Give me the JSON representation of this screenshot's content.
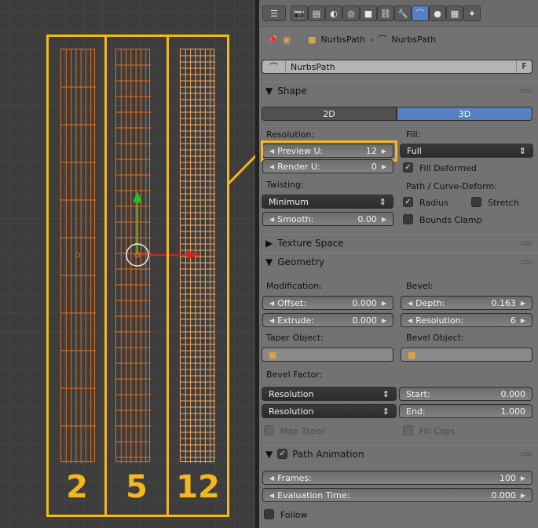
{
  "viewport": {
    "labels": [
      "2",
      "5",
      "12"
    ],
    "wire_color": "#e0701d",
    "highlight_color": "#f4b71c",
    "objects": [
      {
        "resolution_label": "2"
      },
      {
        "resolution_label": "5"
      },
      {
        "resolution_label": "12"
      }
    ]
  },
  "header": {
    "context_icons": [
      "render-icon",
      "render-layers-icon",
      "scene-icon",
      "world-icon",
      "object-icon",
      "constraints-icon",
      "modifiers-icon",
      "curve-data-icon",
      "material-icon",
      "texture-icon",
      "particles-icon"
    ]
  },
  "breadcrumb": {
    "object": "NurbsPath",
    "data": "NurbsPath"
  },
  "datablock": {
    "name": "NurbsPath",
    "fake_user": "F"
  },
  "shape": {
    "title": "Shape",
    "tab_2d": "2D",
    "tab_3d": "3D",
    "resolution_label": "Resolution:",
    "preview_u_label": "Preview U:",
    "preview_u": "12",
    "render_u_label": "Render U:",
    "render_u": "0",
    "fill_label": "Fill:",
    "fill_value": "Full",
    "fill_deformed": "Fill Deformed",
    "twisting_label": "Twisting:",
    "twisting_value": "Minimum",
    "smooth_label": "Smooth:",
    "smooth_value": "0.00",
    "path_deform_label": "Path / Curve-Deform:",
    "radius": "Radius",
    "stretch": "Stretch",
    "bounds_clamp": "Bounds Clamp"
  },
  "texture_space": {
    "title": "Texture Space"
  },
  "geometry": {
    "title": "Geometry",
    "modification_label": "Modification:",
    "offset_label": "Offset:",
    "offset": "0.000",
    "extrude_label": "Extrude:",
    "extrude": "0.000",
    "bevel_label": "Bevel:",
    "depth_label": "Depth:",
    "depth": "0.163",
    "resolution_label": "Resolution:",
    "resolution": "6",
    "taper_object_label": "Taper Object:",
    "bevel_object_label": "Bevel Object:",
    "bevel_factor_label": "Bevel Factor:",
    "bf_mode_1": "Resolution",
    "bf_mode_2": "Resolution",
    "start_label": "Start:",
    "start": "0.000",
    "end_label": "End:",
    "end": "1.000",
    "map_taper": "Map Taper",
    "fill_caps": "Fill Caps"
  },
  "path_animation": {
    "title": "Path Animation",
    "frames_label": "Frames:",
    "frames": "100",
    "eval_label": "Evaluation Time:",
    "eval": "0.000",
    "follow": "Follow"
  }
}
